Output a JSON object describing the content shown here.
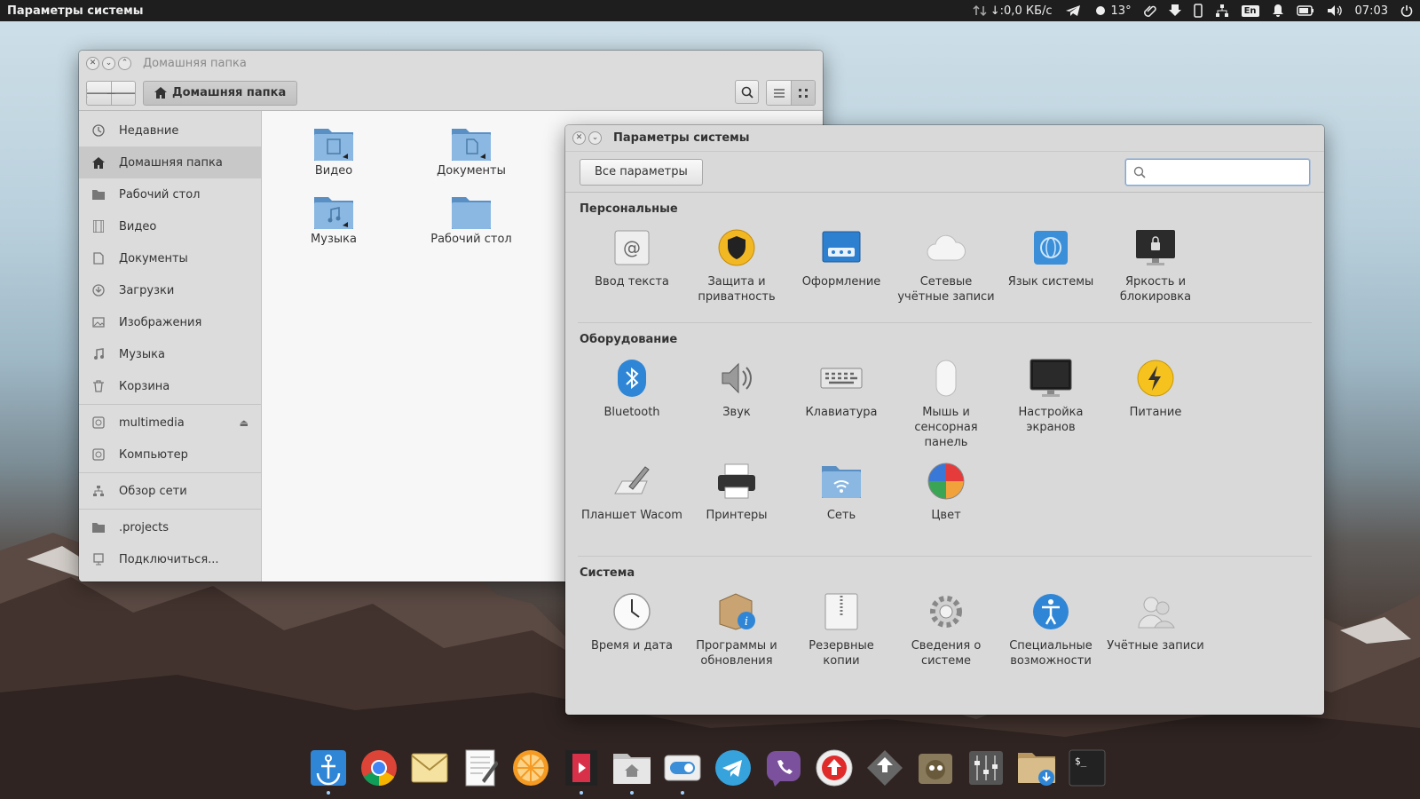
{
  "top_panel": {
    "app_title": "Параметры системы",
    "network_speed": "↓:0,0 КБ/с",
    "weather": "13°",
    "keyboard_layout": "En",
    "clock": "07:03"
  },
  "files_window": {
    "title": "Домашняя папка",
    "breadcrumb": "Домашняя папка",
    "sidebar": {
      "places": [
        "Недавние",
        "Домашняя папка",
        "Рабочий стол",
        "Видео",
        "Документы",
        "Загрузки",
        "Изображения",
        "Музыка",
        "Корзина"
      ],
      "devices": [
        "multimedia",
        "Компьютер"
      ],
      "network": [
        "Обзор сети"
      ],
      "other": [
        ".projects",
        "Подключиться..."
      ]
    },
    "items": [
      "Видео",
      "Документы",
      "Музыка",
      "Рабочий стол"
    ]
  },
  "settings_window": {
    "title": "Параметры системы",
    "all_settings_label": "Все параметры",
    "search_value": "",
    "sections": [
      {
        "title": "Персональные",
        "items": [
          "Ввод текста",
          "Защита и приватность",
          "Оформление",
          "Сетевые учётные записи",
          "Язык системы",
          "Яркость и блокировка"
        ]
      },
      {
        "title": "Оборудование",
        "items": [
          "Bluetooth",
          "Звук",
          "Клавиатура",
          "Мышь и сенсорная панель",
          "Настройка экранов",
          "Питание",
          "Планшет Wacom",
          "Принтеры",
          "Сеть",
          "Цвет"
        ]
      },
      {
        "title": "Система",
        "items": [
          "Время и дата",
          "Программы и обновления",
          "Резервные копии",
          "Сведения о системе",
          "Специальные возможности",
          "Учётные записи"
        ]
      }
    ]
  },
  "dock": {
    "items": [
      "anchor-launcher-icon",
      "chrome-icon",
      "mail-icon",
      "text-editor-icon",
      "orange-icon",
      "video-player-icon",
      "files-icon",
      "switchboard-icon",
      "telegram-icon",
      "viber-icon",
      "upload-icon",
      "package-icon",
      "gimp-icon",
      "mixer-icon",
      "downloads-icon",
      "terminal-icon"
    ]
  },
  "colors": {
    "panel": "#1e1e1e",
    "window": "#dcdcdc",
    "accent": "#3b8fd9"
  }
}
